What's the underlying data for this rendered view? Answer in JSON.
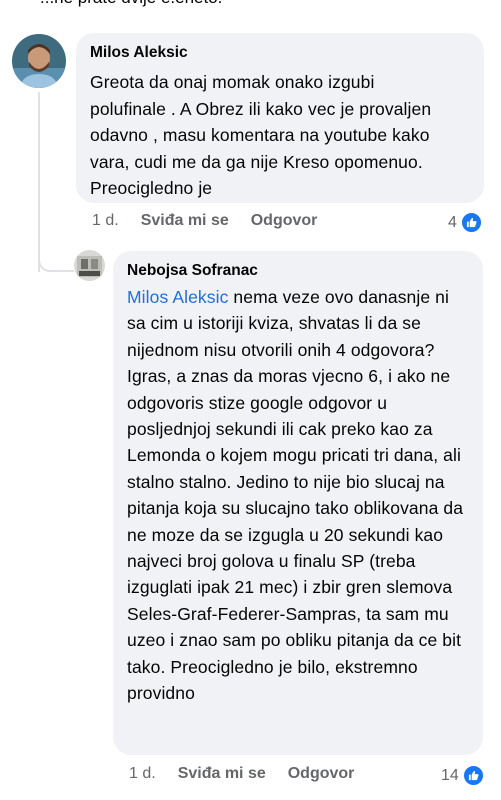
{
  "top_fragment": "...ne prate dvije e.eneto.",
  "comments": [
    {
      "author": "Milos Aleksic",
      "text": "Greota da onaj momak onako izgubi polufinale . A Obrez ili kako vec je provaljen odavno , masu komentara na youtube kako vara, cudi me da ga nije Kreso opomenuo. Preocigledno je",
      "time": "1 d.",
      "like_label": "Sviđa mi se",
      "reply_label": "Odgovor",
      "reaction_count": "4"
    },
    {
      "author": "Nebojsa Sofranac",
      "mention": "Milos Aleksic",
      "text": " nema veze ovo danasnje ni sa cim u istoriji kviza, shvatas li da se nijednom nisu otvorili onih 4 odgovora? Igras, a znas da moras vjecno 6, i ako ne odgovoris stize google odgovor u posljednjoj sekundi ili cak preko kao za Lemonda o kojem mogu pricati tri dana, ali stalno stalno. Jedino to nije bio slucaj na pitanja koja su slucajno tako oblikovana da ne moze da se izgugla u 20 sekundi kao najveci broj golova u finalu SP (treba izguglati ipak 21 mec) i zbir gren slemova Seles-Graf-Federer-Sampras, ta sam mu uzeo i znao sam po obliku pitanja da ce bit tako. Preocigledno je bilo, ekstremno providno",
      "time": "1 d.",
      "like_label": "Sviđa mi se",
      "reply_label": "Odgovor",
      "reaction_count": "14"
    }
  ],
  "icons": {
    "reaction": "like-icon",
    "colors": {
      "accent": "#1877f2",
      "mention": "#216fdb",
      "bubble": "#f0f2f5",
      "meta": "#65676b"
    }
  }
}
